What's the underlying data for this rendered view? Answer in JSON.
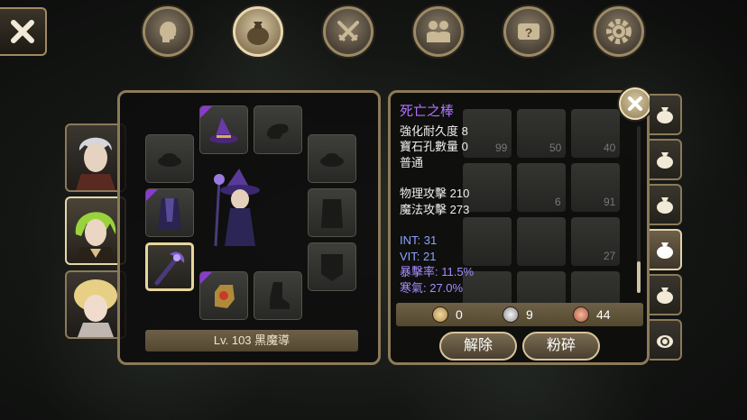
{
  "header": {
    "tabs": [
      {
        "name": "character",
        "icon": "head-icon"
      },
      {
        "name": "inventory",
        "icon": "bag-icon",
        "active": true
      },
      {
        "name": "battle",
        "icon": "crossed-swords-icon"
      },
      {
        "name": "party",
        "icon": "people-icon"
      },
      {
        "name": "quest",
        "icon": "scroll-icon"
      },
      {
        "name": "settings",
        "icon": "gear-icon"
      }
    ]
  },
  "characters": [
    {
      "name": "white-hair-knight"
    },
    {
      "name": "green-hair-mage",
      "active": true
    },
    {
      "name": "blonde-girl"
    }
  ],
  "equipment": {
    "level_label": "Lv. 103 黑魔導"
  },
  "item_detail": {
    "name": "死亡之棒",
    "lines1": [
      "強化耐久度 8",
      "寶石孔數量 0",
      "普通"
    ],
    "lines2": [
      "物理攻擊 210",
      "魔法攻擊 273"
    ],
    "stats_blue": [
      "INT: 31",
      "VIT: 21"
    ],
    "stats_purple": [
      "暴擊率: 11.5%",
      "寒氣: 27.0%"
    ],
    "grid_counts": [
      "99",
      "50",
      "40",
      "6",
      "91",
      "27"
    ]
  },
  "currency": {
    "gold": "0",
    "silver": "9",
    "copper": "44"
  },
  "actions": {
    "unequip_label": "解除",
    "crush_label": "粉碎"
  },
  "colors": {
    "accent_gold": "#8c7a58",
    "item_name": "#b072ff",
    "stat_blue": "#8aa4ff"
  }
}
